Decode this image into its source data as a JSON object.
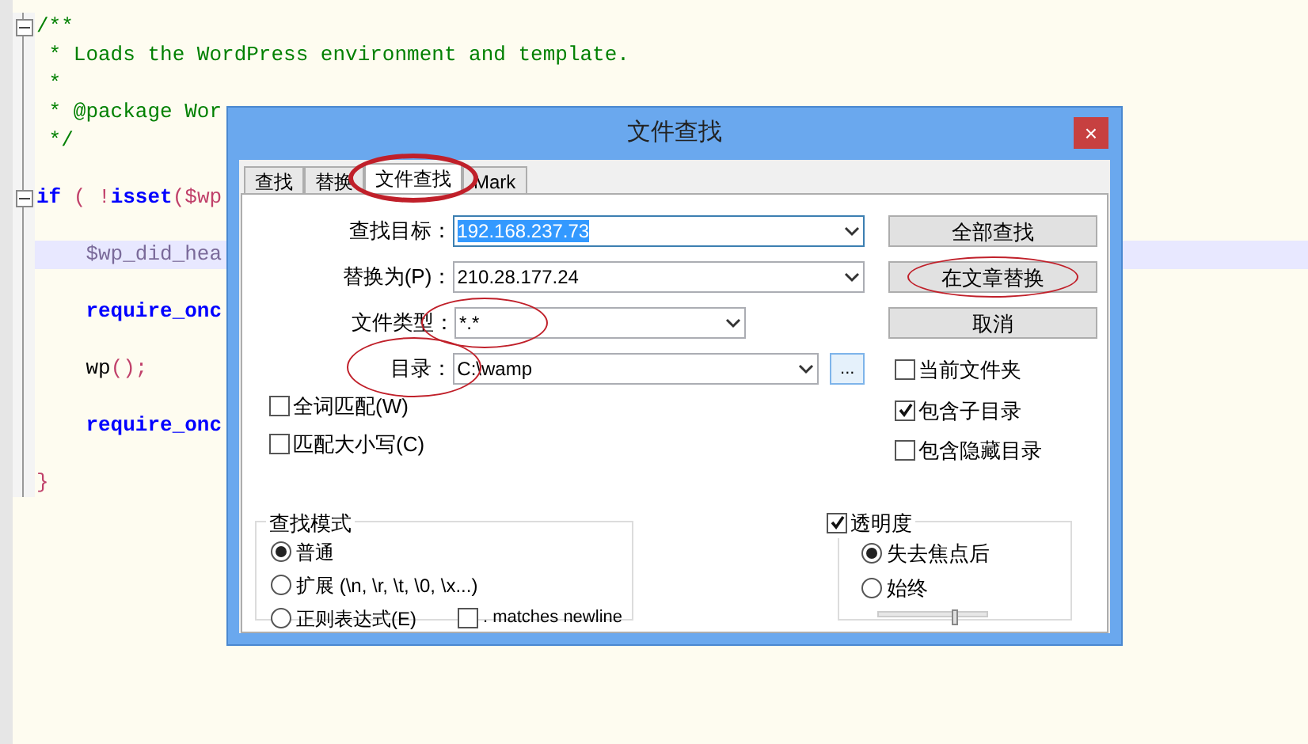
{
  "editor": {
    "lines": [
      {
        "segments": [
          {
            "text": "/**",
            "kind": "comment"
          }
        ],
        "fold": true,
        "current": false
      },
      {
        "segments": [
          {
            "text": " * Loads the WordPress environment and template.",
            "kind": "comment"
          }
        ],
        "fold": false,
        "current": false
      },
      {
        "segments": [
          {
            "text": " *",
            "kind": "comment"
          }
        ],
        "fold": false,
        "current": false
      },
      {
        "segments": [
          {
            "text": " * @package Wor",
            "kind": "comment"
          }
        ],
        "fold": false,
        "current": false
      },
      {
        "segments": [
          {
            "text": " */",
            "kind": "comment"
          }
        ],
        "fold": false,
        "current": false
      },
      {
        "blank": true
      },
      {
        "segments": [
          {
            "text": "if",
            "kind": "keyword"
          },
          {
            "text": " ( !",
            "kind": "operator"
          },
          {
            "text": "isset",
            "kind": "keyword"
          },
          {
            "text": "($wp",
            "kind": "operator"
          }
        ],
        "fold": true,
        "current": false
      },
      {
        "blank": true
      },
      {
        "segments": [
          {
            "text": "    $wp_did_hea",
            "kind": "variable"
          }
        ],
        "fold": false,
        "current": true
      },
      {
        "blank": true
      },
      {
        "segments": [
          {
            "text": "    require_onc",
            "kind": "keyword"
          }
        ],
        "fold": false,
        "current": false
      },
      {
        "blank": true
      },
      {
        "segments": [
          {
            "text": "    wp",
            "kind": "plain"
          },
          {
            "text": "();",
            "kind": "operator"
          }
        ],
        "fold": false,
        "current": false
      },
      {
        "blank": true
      },
      {
        "segments": [
          {
            "text": "    require_onc",
            "kind": "keyword"
          }
        ],
        "fold": false,
        "current": false
      },
      {
        "blank": true
      },
      {
        "segments": [
          {
            "text": "}",
            "kind": "operator"
          }
        ],
        "fold": false,
        "current": false
      }
    ]
  },
  "dialog": {
    "title": "文件查找",
    "close": "×",
    "tabs": [
      {
        "label": "查找",
        "selected": false,
        "circled": false
      },
      {
        "label": "替换",
        "selected": false,
        "circled": false
      },
      {
        "label": "文件查找",
        "selected": true,
        "circled": true
      },
      {
        "label": "Mark",
        "selected": false,
        "circled": false
      }
    ],
    "fields": [
      {
        "label": "查找目标：",
        "value": "192.168.237.73",
        "highlighted": true,
        "circled": false,
        "kind": "combo"
      },
      {
        "label": "替换为(P)：",
        "value": "210.28.177.24",
        "highlighted": false,
        "circled": false,
        "kind": "combo"
      },
      {
        "label": "文件类型：",
        "value": "*.*",
        "highlighted": false,
        "circled": true,
        "kind": "short"
      },
      {
        "label": "目录：",
        "value": "C:\\wamp",
        "highlighted": false,
        "circled": true,
        "kind": "path",
        "browse": "..."
      }
    ],
    "buttons": [
      {
        "label": "全部查找",
        "circled": false
      },
      {
        "label": "在文章替换",
        "circled": true
      },
      {
        "label": "取消",
        "circled": false
      }
    ],
    "left_options": [
      {
        "label": "全词匹配(W)",
        "checked": false
      },
      {
        "label": "匹配大小写(C)",
        "checked": false
      }
    ],
    "right_options": [
      {
        "label": "当前文件夹",
        "checked": false
      },
      {
        "label": "包含子目录",
        "checked": true
      },
      {
        "label": "包含隐藏目录",
        "checked": false
      }
    ],
    "search_mode": {
      "title": "查找模式",
      "options": [
        {
          "label": "普通",
          "selected": true
        },
        {
          "label": "扩展 (\\n, \\r, \\t, \\0, \\x...)",
          "selected": false
        },
        {
          "label": "正则表达式(E)",
          "selected": false
        }
      ],
      "dot_newline": {
        "label": ". matches newline",
        "checked": false
      }
    },
    "transparency": {
      "label": "透明度",
      "checked": true,
      "options": [
        {
          "label": "失去焦点后",
          "selected": true
        },
        {
          "label": "始终",
          "selected": false
        }
      ],
      "level": 0.7
    }
  }
}
